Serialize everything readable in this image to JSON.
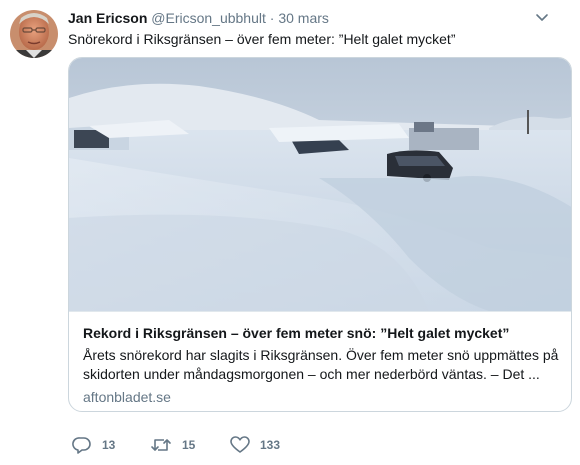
{
  "tweet": {
    "author_name": "Jan Ericson",
    "handle": "@Ericson_ubbhult",
    "separator": "·",
    "time": "30 mars",
    "text": "Snörekord i Riksgränsen – över fem meter: ”Helt galet mycket”"
  },
  "card": {
    "title": "Rekord i Riksgränsen – över fem meter snö: ”Helt galet mycket”",
    "description": "Årets snörekord har slagits i Riksgränsen. Över fem meter snö uppmättes på skidorten under måndagsmorgonen – och mer nederbörd väntas. – Det ...",
    "domain": "aftonbladet.se"
  },
  "actions": {
    "reply_count": "13",
    "retweet_count": "15",
    "like_count": "133"
  },
  "icons": {
    "caret": "chevron-down-icon",
    "reply": "reply-icon",
    "retweet": "retweet-icon",
    "like": "heart-icon"
  },
  "colors": {
    "secondary_text": "#657786",
    "border": "#ccd6dd"
  }
}
